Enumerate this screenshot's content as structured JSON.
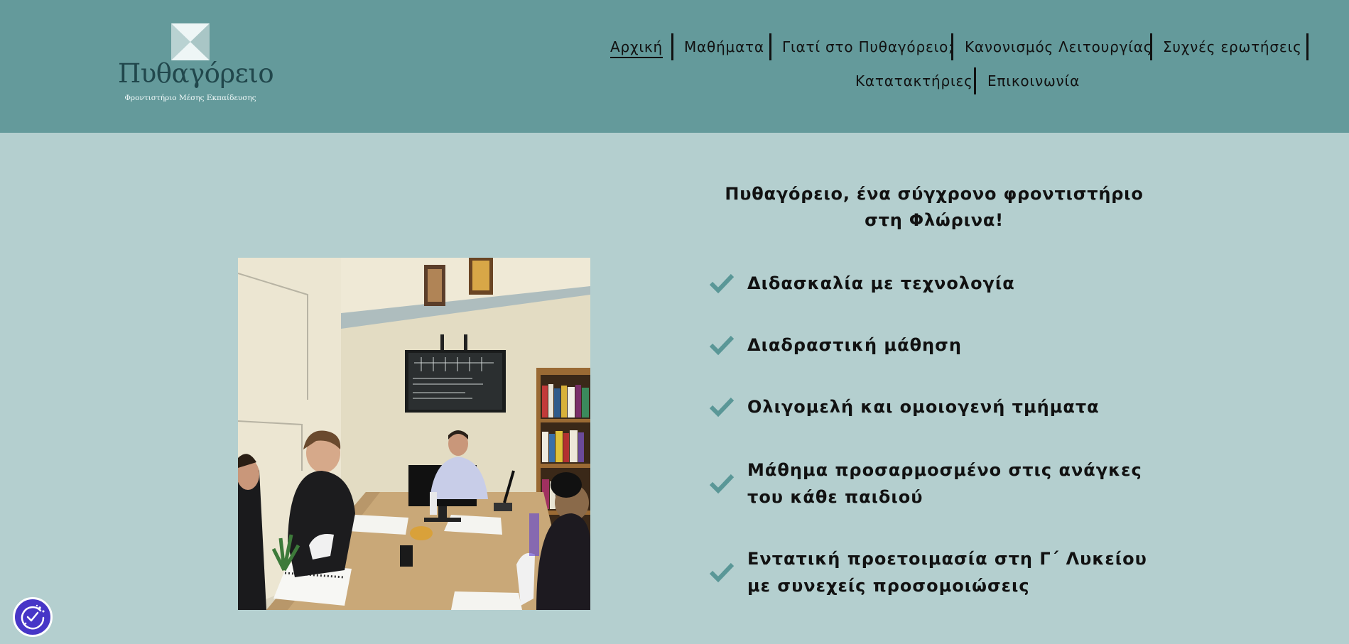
{
  "brand": {
    "name": "Πυθαγόρειο",
    "subtitle": "Φροντιστήριο Μέσης Εκπαίδευσης"
  },
  "nav": {
    "items": [
      "Αρχική",
      "Μαθήματα",
      "Γιατί στο Πυθαγόρειο;",
      "Κανονισμός Λειτουργίας",
      "Συχνές ερωτήσεις",
      "Κατατακτήριες",
      "Επικοινωνία"
    ],
    "active": "Αρχική"
  },
  "intro": {
    "headline": "Πυθαγόρειο, ένα σύγχρονο φροντιστήριο στη Φλώρινα!"
  },
  "features": [
    "Διδασκαλία με τεχνολογία",
    "Διαδραστική μάθηση",
    "Ολιγομελή και ομοιογενή τμήματα",
    "Μάθημα προσαρμοσμένο στις ανάγκες του κάθε παιδιού",
    "Εντατική προετοιμασία στη Γ΄ Λυκείου με συνεχείς προσομοιώσεις"
  ],
  "icons": {
    "feature_bullet": "check-icon",
    "cookie_button": "cookie-consent-icon"
  },
  "colors": {
    "header_bg": "#649a9b",
    "page_bg": "#b4cfcf",
    "accent": "#5a9797",
    "cookie_button": "#4736c7"
  }
}
